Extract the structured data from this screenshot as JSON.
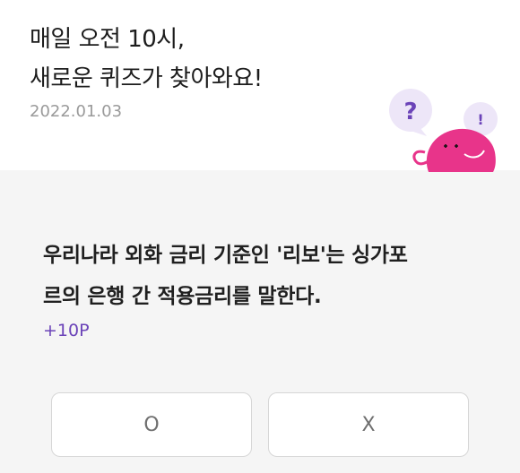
{
  "header": {
    "headline_line1": "매일 오전 10시,",
    "headline_line2": "새로운 퀴즈가 찾아와요!",
    "date": "2022.01.03",
    "illustration": {
      "bubble_mark": "?",
      "exclaim_mark": "!",
      "bubble_color": "#ede6f8",
      "mark_color": "#6b43b8",
      "character_color": "#e8348a"
    }
  },
  "quiz": {
    "question_line1": "우리나라 외화 금리 기준인 '리보'는 싱가포",
    "question_line2": "르의 은행 간 적용금리를 말한다.",
    "points": "+10P"
  },
  "answers": {
    "o_label": "O",
    "x_label": "X"
  },
  "colors": {
    "accent": "#6b43b8",
    "background": "#f5f5f5"
  }
}
